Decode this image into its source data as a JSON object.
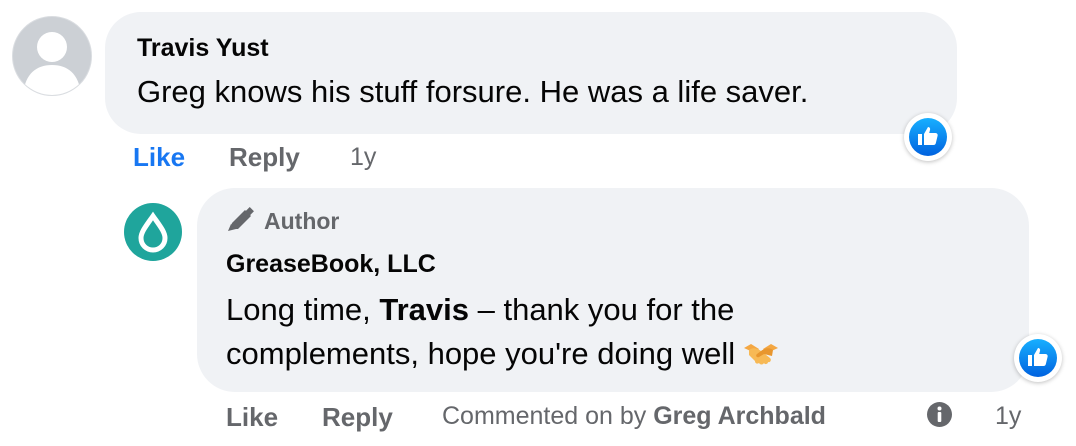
{
  "comment": {
    "author": "Travis Yust",
    "text": "Greg knows his stuff forsure. He was a life saver.",
    "reaction_icon": "like-reaction-icon",
    "actions": {
      "like_label": "Like",
      "reply_label": "Reply",
      "timestamp": "1y"
    }
  },
  "reply": {
    "badge_label": "Author",
    "author": "GreaseBook, LLC",
    "text": {
      "before_mention": "Long time, ",
      "mention": "Travis",
      "after_mention": " – thank you for the",
      "line2": "complements, hope you're doing well"
    },
    "emoji": "handshake-emoji",
    "reaction_icon": "like-reaction-icon",
    "actions": {
      "like_label": "Like",
      "reply_label": "Reply",
      "commented_prefix": "Commented on by ",
      "commented_by": "Greg Archbald",
      "timestamp": "1y"
    }
  },
  "colors": {
    "link_active": "#1877f2",
    "meta_gray": "#65676b",
    "bubble_bg": "#f0f2f5",
    "brand_teal": "#1fa59c"
  }
}
